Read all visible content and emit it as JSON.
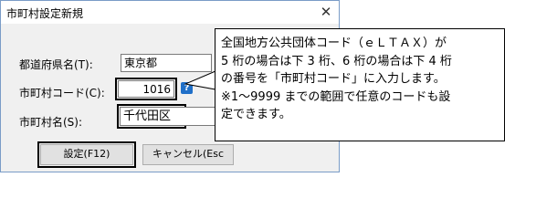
{
  "window": {
    "title": "市町村設定新規",
    "close_glyph": "✕"
  },
  "form": {
    "prefecture_label": "都道府県名(T):",
    "prefecture_value": "東京都",
    "city_code_label": "市町村コード(C):",
    "city_code_value": "1016",
    "city_name_label": "市町村名(S):",
    "city_name_value": "千代田区",
    "help_glyph": "?"
  },
  "buttons": {
    "settings_label": "設定(F12)",
    "cancel_label": "キャンセル(Esc"
  },
  "callout": {
    "lines": [
      "全国地方公共団体コード（ｅＬＴＡＸ）が",
      "5 桁の場合は下 3 桁、6 桁の場合は下 4 桁",
      "の番号を「市町村コード」に入力します。",
      "※1～9999 までの範囲で任意のコードも設",
      "定できます。"
    ]
  },
  "colors": {
    "window_border": "#7a9cc7",
    "dialog_bg": "#f0f0f0",
    "help_icon": "#1f6fc8",
    "highlight": "#000000"
  }
}
